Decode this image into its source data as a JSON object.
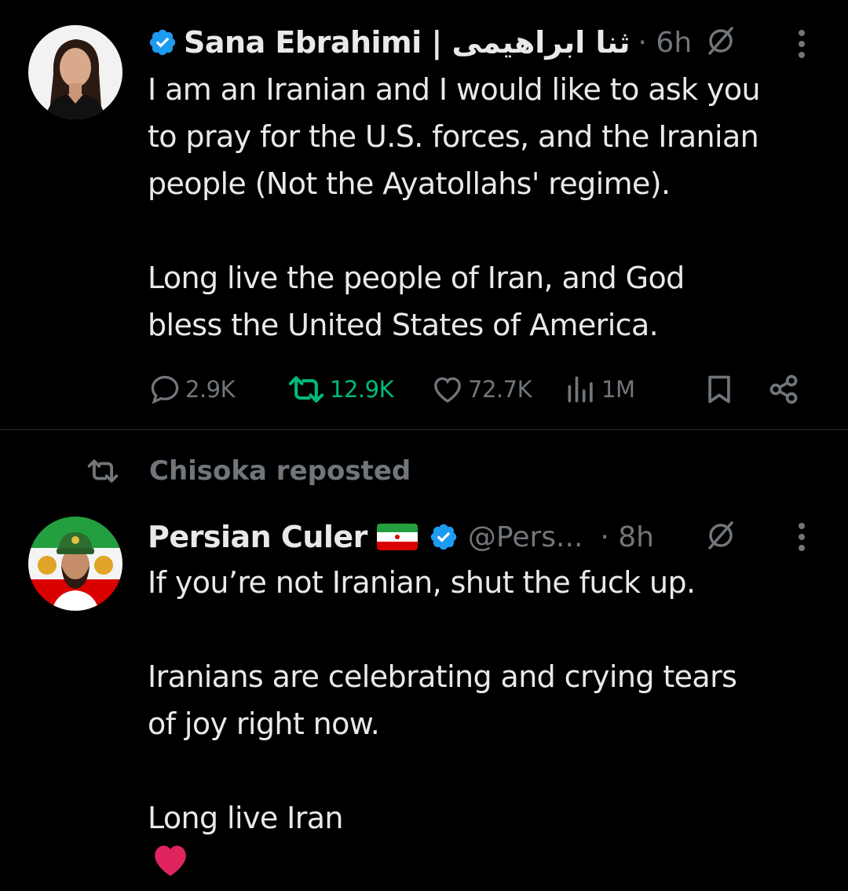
{
  "tweets": [
    {
      "author": {
        "name": "Sana Ebrahimi | ثنا ابراهیمی",
        "verified": true
      },
      "time": "· 6h",
      "paragraphs": [
        [
          "I am an Iranian and I would like to ask you",
          "to pray for the U.S. forces, and the Iranian",
          "people (Not the Ayatollahs' regime)."
        ],
        [
          "Long live the people of Iran, and God",
          "bless the United States of America."
        ]
      ],
      "stats": {
        "replies": "2.9K",
        "reposts": "12.9K",
        "likes": "72.7K",
        "views": "1M"
      },
      "reposted": true
    },
    {
      "repost_context": "Chisoka reposted",
      "author": {
        "name": "Persian Culer",
        "flag": "iran-flag",
        "verified": true,
        "handle": "@Pers..."
      },
      "time": "· 8h",
      "paragraphs": [
        [
          "If you’re not Iranian, shut the fuck up."
        ],
        [
          "Iranians are celebrating and crying tears",
          "of joy right now."
        ],
        [
          "Long live Iran"
        ]
      ],
      "emoji_suffix": [
        "iran-flag",
        "red-heart-icon"
      ]
    }
  ],
  "colors": {
    "background": "#000000",
    "text_primary": "#e7e9ea",
    "text_secondary": "#71767b",
    "verified_blue": "#1d9bf0",
    "retweet_green": "#00ba7c",
    "divider": "#2f3336"
  }
}
